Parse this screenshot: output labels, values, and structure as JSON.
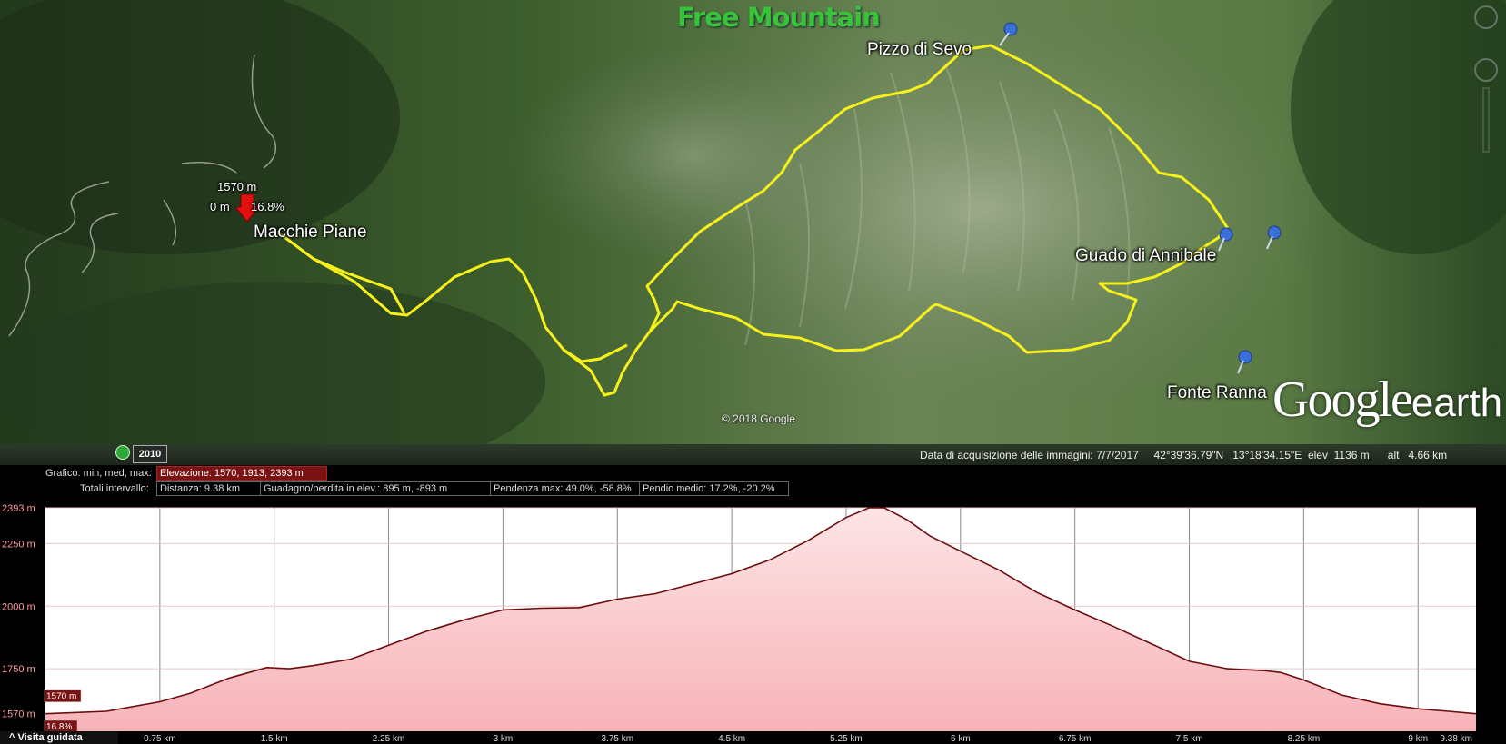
{
  "map": {
    "brand": "Free Mountain",
    "labels": {
      "pizzo": "Pizzo di Sevo",
      "macchie": "Macchie Piane",
      "guado": "Guado di Annibale",
      "fonte": "Fonte Ranna"
    },
    "marker": {
      "elevation": "1570 m",
      "distance": "0 m",
      "slope": "16.8%"
    },
    "copyright": "© 2018 Google",
    "logo_google": "Google",
    "logo_earth": "earth",
    "track_color": "#f6f11a",
    "pin_color": "#3a6fd8",
    "history_year": "2010",
    "status": "Data di acquisizione delle immagini: 7/7/2017     42°39'36.79\"N   13°18'34.15\"E  elev  1136 m      alt   4.66 km"
  },
  "profile": {
    "graph_caption": "Grafico: min, med, max:",
    "elevation_box": "Elevazione: 1570, 1913, 2393 m",
    "totals_caption": "Totali intervallo:",
    "distance_box": "Distanza: 9.38 km",
    "gain_box": "Guadagno/perdita in elev.: 895 m, -893 m",
    "slope_max_box": "Pendenza max: 49.0%, -58.8%",
    "slope_avg_box": "Pendio medio: 17.2%, -20.2%",
    "cursor_elev": "1570 m",
    "cursor_slope": "16.8%",
    "guided_tour": "Visita guidata"
  },
  "chart_data": {
    "type": "area",
    "ylabels": [
      "2393 m",
      "2250 m",
      "2000 m",
      "1750 m",
      "1570 m"
    ],
    "yticks": [
      2393,
      2250,
      2000,
      1750,
      1570
    ],
    "ylim": [
      1500,
      2393
    ],
    "xlim": [
      0,
      9.38
    ],
    "xticks": [
      0.75,
      1.5,
      2.25,
      3,
      3.75,
      4.5,
      5.25,
      6,
      6.75,
      7.5,
      8.25,
      9,
      9.38
    ],
    "xlabels": [
      "0.75 km",
      "1.5 km",
      "2.25 km",
      "3 km",
      "3.75 km",
      "4.5 km",
      "5.25 km",
      "6 km",
      "6.75 km",
      "7.5 km",
      "8.25 km",
      "9 km",
      "9.38 km"
    ],
    "line_color": "#6b0d0d",
    "fill_color": "#f7b3b8",
    "x": [
      0,
      0.4,
      0.75,
      0.95,
      1.2,
      1.45,
      1.6,
      1.75,
      2.0,
      2.25,
      2.5,
      2.75,
      3.0,
      3.25,
      3.5,
      3.75,
      4.0,
      4.25,
      4.5,
      4.75,
      5.0,
      5.25,
      5.4,
      5.5,
      5.65,
      5.8,
      6.0,
      6.25,
      6.5,
      6.75,
      7.0,
      7.25,
      7.5,
      7.75,
      8.0,
      8.1,
      8.25,
      8.5,
      8.75,
      9.0,
      9.2,
      9.38
    ],
    "y": [
      1570,
      1580,
      1618,
      1652,
      1712,
      1755,
      1750,
      1762,
      1788,
      1844,
      1900,
      1946,
      1985,
      1992,
      1994,
      2028,
      2050,
      2090,
      2130,
      2185,
      2262,
      2354,
      2393,
      2393,
      2345,
      2280,
      2220,
      2145,
      2055,
      1985,
      1920,
      1850,
      1780,
      1750,
      1742,
      1735,
      1705,
      1645,
      1610,
      1590,
      1580,
      1570
    ]
  }
}
